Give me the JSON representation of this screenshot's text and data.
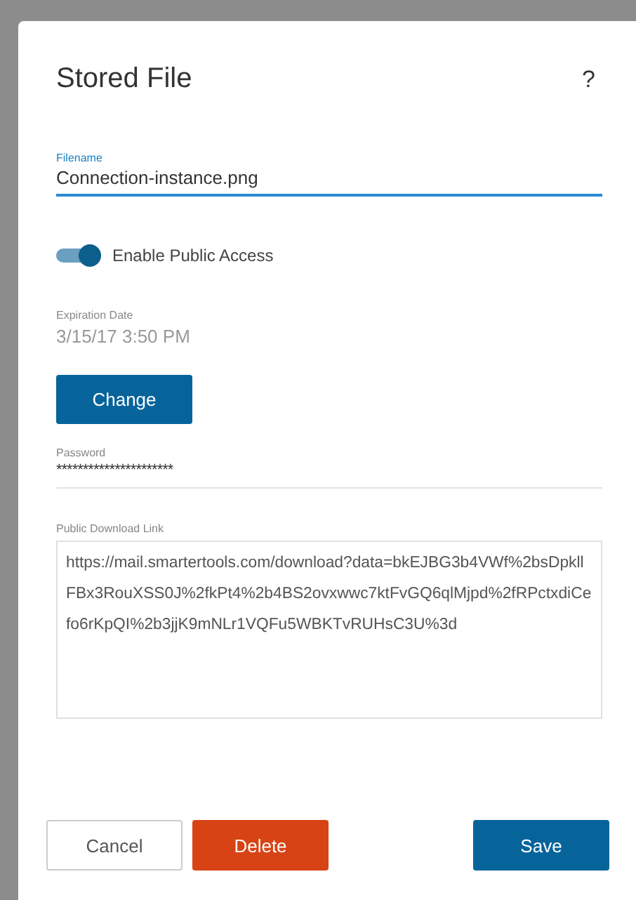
{
  "dialog": {
    "title": "Stored File",
    "help": "?"
  },
  "filename": {
    "label": "Filename",
    "value": "Connection-instance.png",
    "focused": true
  },
  "public_access": {
    "label": "Enable Public Access",
    "on": true
  },
  "expiration": {
    "label": "Expiration Date",
    "value": "3/15/17 3:50 PM"
  },
  "change_button": "Change",
  "password": {
    "label": "Password",
    "value": "**********************"
  },
  "download_link": {
    "label": "Public Download Link",
    "value": "https://mail.smartertools.com/download?data=bkEJBG3b4VWf%2bsDpkllFBx3RouXSS0J%2fkPt4%2b4BS2ovxwwc7ktFvGQ6qlMjpd%2fRPctxdiCefo6rKpQI%2b3jjK9mNLr1VQFu5WBKTvRUHsC3U%3d"
  },
  "buttons": [
    {
      "label": "Cancel",
      "kind": "plain"
    },
    {
      "label": "Delete",
      "kind": "danger"
    },
    {
      "label": "Save",
      "kind": "primary"
    }
  ]
}
